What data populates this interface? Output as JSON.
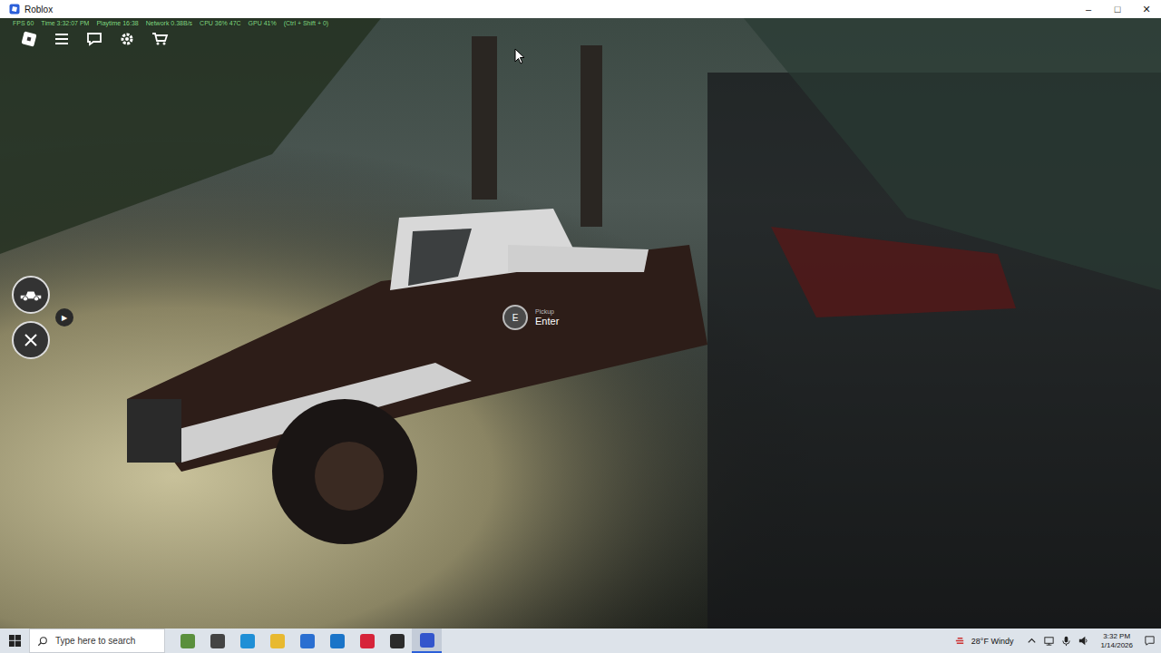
{
  "window": {
    "title": "Roblox",
    "controls": [
      "–",
      "□",
      "✕"
    ]
  },
  "stats": [
    "FPS 60",
    "Time 3:32:07 PM",
    "Playtime 16:38",
    "Network 0.38B/s",
    "CPU 36% 47C",
    "GPU 41%",
    "(Ctrl + Shift + 0)"
  ],
  "hud": {
    "play_glyph": "▶"
  },
  "prompt": {
    "key": "E",
    "object": "Pickup",
    "action": "Enter"
  },
  "taskbar": {
    "search_placeholder": "Type here to search",
    "apps": [
      {
        "selected": false,
        "color": "#5a8f3c"
      },
      {
        "selected": false,
        "color": "#444444"
      },
      {
        "selected": false,
        "color": "#1f8fd6"
      },
      {
        "selected": false,
        "color": "#e8b930"
      },
      {
        "selected": false,
        "color": "#2a6fd1"
      },
      {
        "selected": false,
        "color": "#1a74c8"
      },
      {
        "selected": false,
        "color": "#d6243a"
      },
      {
        "selected": false,
        "color": "#2b2b2b"
      },
      {
        "selected": true,
        "color": "#3355cc"
      }
    ],
    "weather": "28°F Windy",
    "time": "3:32 PM",
    "date": "1/14/2026"
  }
}
